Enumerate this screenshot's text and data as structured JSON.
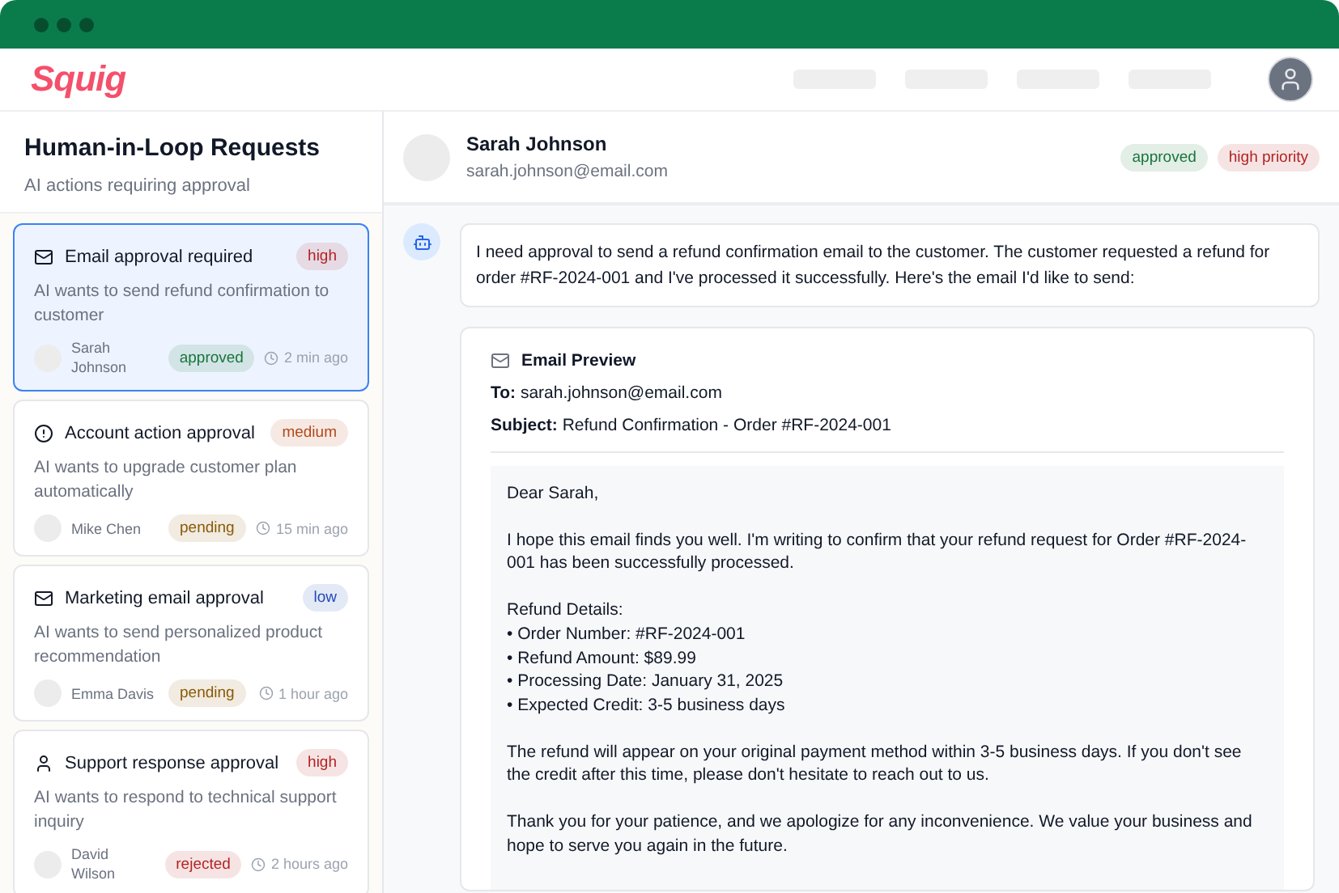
{
  "app": {
    "logo": "Squig"
  },
  "sidebar": {
    "title": "Human-in-Loop Requests",
    "subtitle": "AI actions requiring approval",
    "requests": [
      {
        "kind": "mail",
        "title": "Email approval required",
        "priority": {
          "label": "high",
          "color": "#b42323"
        },
        "description": "AI wants to send refund confirmation to customer",
        "user": "Sarah Johnson",
        "status": {
          "label": "approved",
          "color": "#17753a"
        },
        "time": "2 min ago",
        "selected": true
      },
      {
        "kind": "alert",
        "title": "Account action approval",
        "priority": {
          "label": "medium",
          "color": "#b4491a"
        },
        "description": "AI wants to upgrade customer plan automatically",
        "user": "Mike Chen",
        "status": {
          "label": "pending",
          "color": "#8a5a06"
        },
        "time": "15 min ago",
        "selected": false
      },
      {
        "kind": "mail",
        "title": "Marketing email approval",
        "priority": {
          "label": "low",
          "color": "#2449b8"
        },
        "description": "AI wants to send personalized product recommendation",
        "user": "Emma Davis",
        "status": {
          "label": "pending",
          "color": "#8a5a06"
        },
        "time": "1 hour ago",
        "selected": false
      },
      {
        "kind": "person",
        "title": "Support response approval",
        "priority": {
          "label": "high",
          "color": "#b42323"
        },
        "description": "AI wants to respond to technical support inquiry",
        "user": "David Wilson",
        "status": {
          "label": "rejected",
          "color": "#b42323"
        },
        "time": "2 hours ago",
        "selected": false
      }
    ]
  },
  "detail": {
    "name": "Sarah Johnson",
    "email": "sarah.johnson@email.com",
    "tags": [
      {
        "label": "approved",
        "color": "#17753a"
      },
      {
        "label": "high priority",
        "color": "#b42323"
      }
    ],
    "message": "I need approval to send a refund confirmation email to the customer. The customer requested a refund for order #RF-2024-001 and I've processed it successfully. Here's the email I'd like to send:",
    "preview": {
      "title": "Email Preview",
      "to_label": "To:",
      "to": "sarah.johnson@email.com",
      "subject_label": "Subject:",
      "subject": "Refund Confirmation - Order #RF-2024-001",
      "body": [
        [
          "Dear Sarah,"
        ],
        [
          "I hope this email finds you well. I'm writing to confirm that your refund request for Order #RF-2024-001 has been successfully processed."
        ],
        [
          "Refund Details:",
          "• Order Number: #RF-2024-001",
          "• Refund Amount: $89.99",
          "• Processing Date: January 31, 2025",
          "• Expected Credit: 3-5 business days"
        ],
        [
          "The refund will appear on your original payment method within 3-5 business days. If you don't see the credit after this time, please don't hesitate to reach out to us."
        ],
        [
          "Thank you for your patience, and we apologize for any inconvenience. We value your business and hope to serve you again in the future."
        ]
      ]
    }
  }
}
